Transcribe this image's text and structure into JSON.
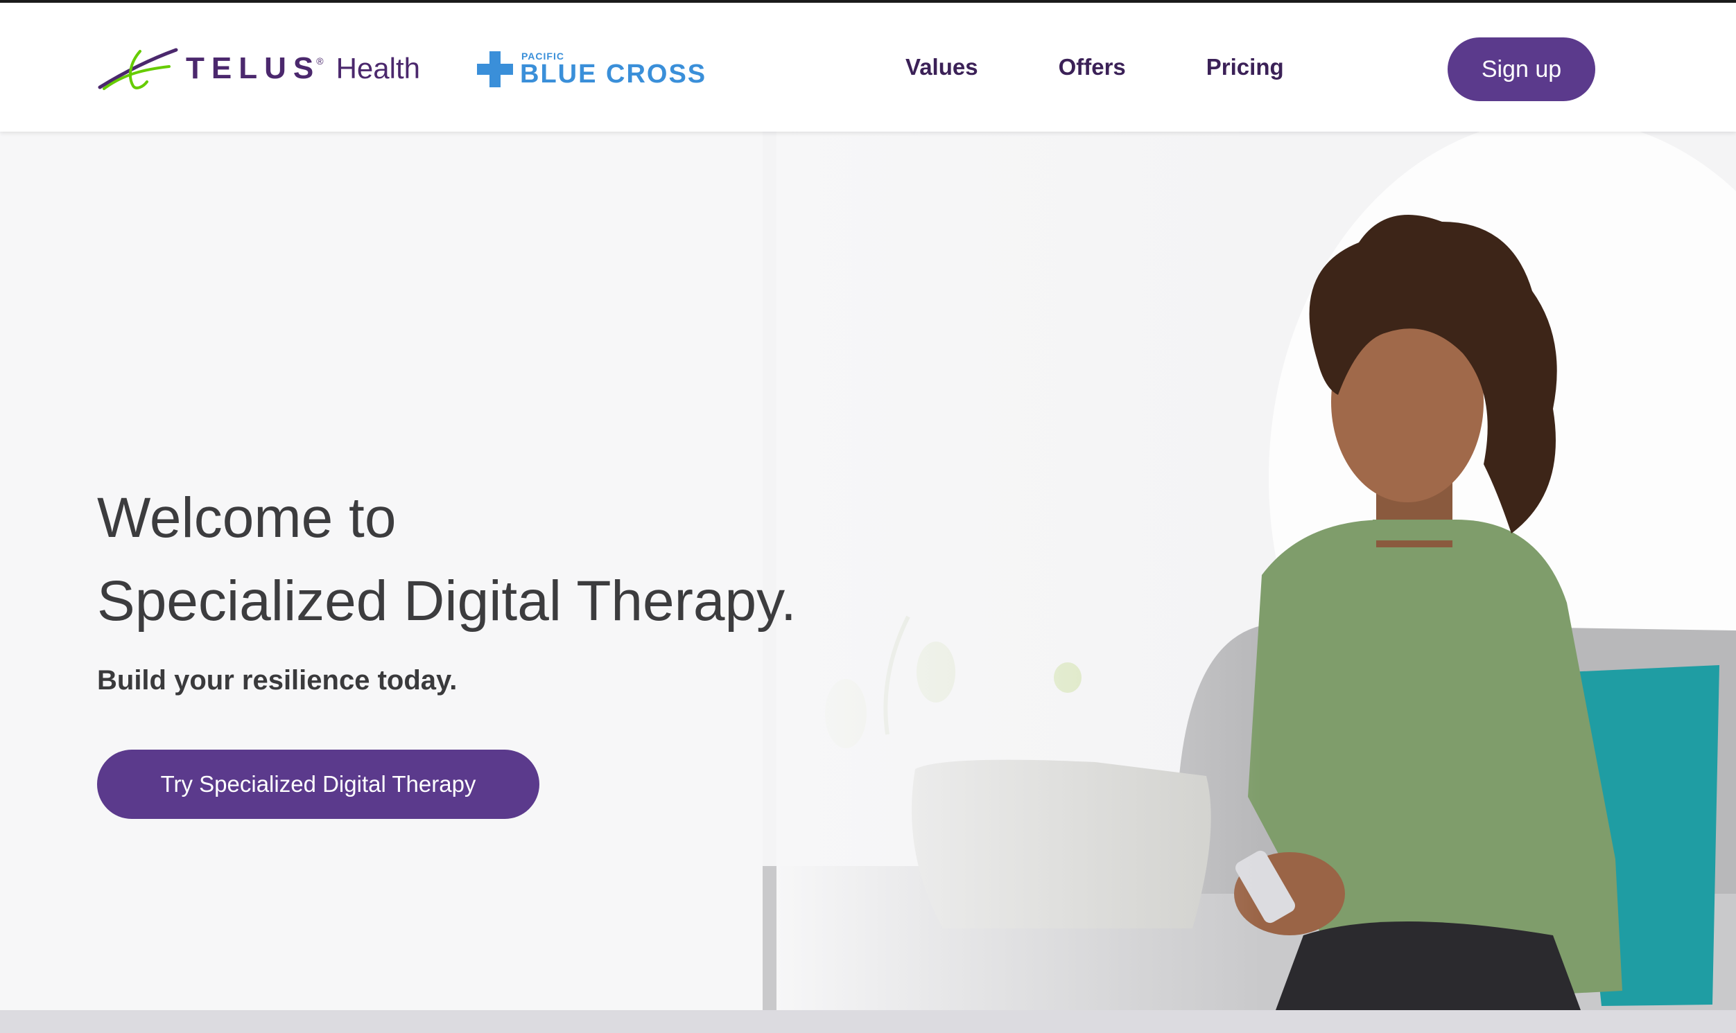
{
  "header": {
    "telus_logo": {
      "brand": "TELUS",
      "product": "Health",
      "registered": "®"
    },
    "partner_logo": {
      "small_text": "PACIFIC",
      "big_text": "BLUE CROSS"
    },
    "nav": [
      {
        "label": "Values"
      },
      {
        "label": "Offers"
      },
      {
        "label": "Pricing"
      }
    ],
    "signup_label": "Sign up"
  },
  "hero": {
    "title_line1": "Welcome to",
    "title_line2": "Specialized Digital Therapy.",
    "subtitle": "Build your resilience today.",
    "cta_label": "Try Specialized Digital Therapy"
  },
  "colors": {
    "brand_purple": "#5b3a8c",
    "nav_text": "#3b2157",
    "telus_purple": "#4b286d",
    "telus_green": "#66cc00",
    "pbc_blue": "#3a8fd9",
    "hero_bg": "#f7f7f8"
  },
  "icons": {
    "telus_mark": "telus-swoosh-icon",
    "pbc_mark": "blue-cross-icon"
  }
}
